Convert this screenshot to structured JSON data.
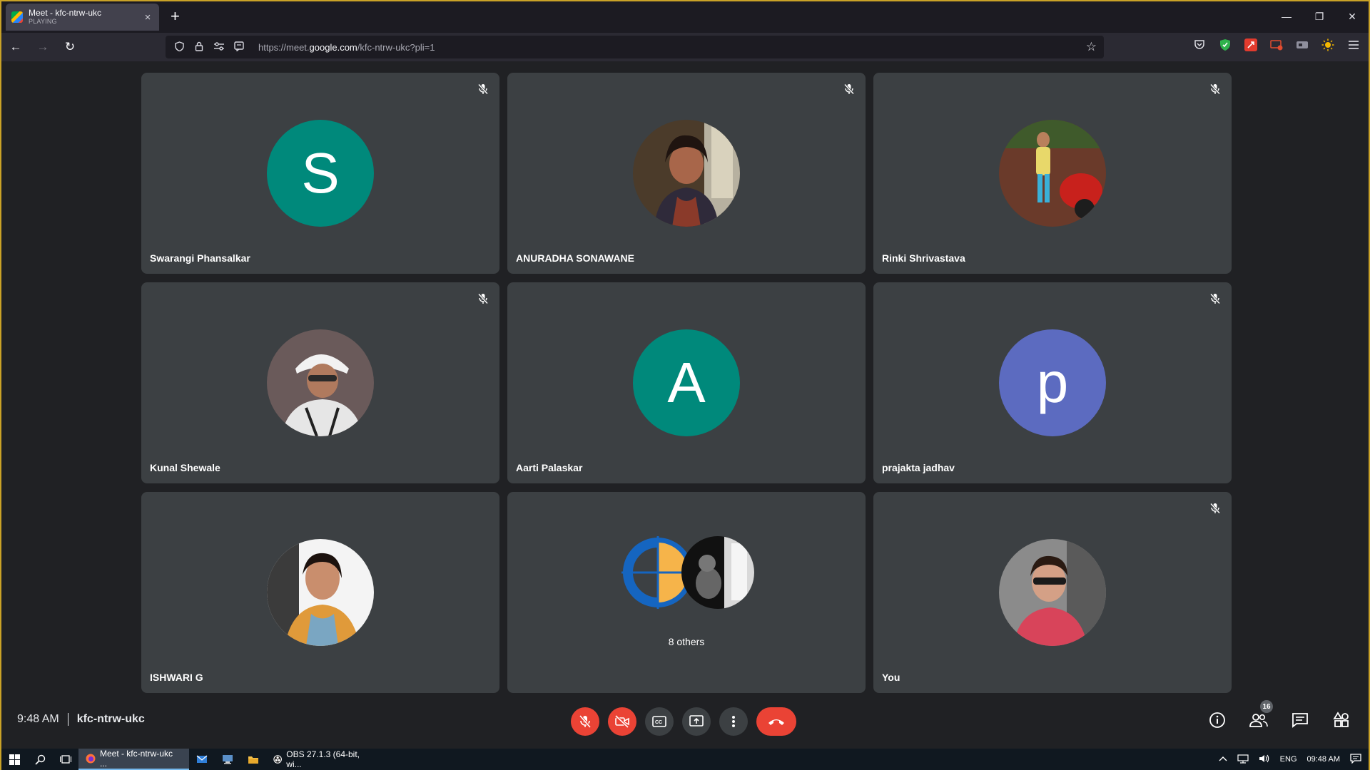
{
  "browser": {
    "tab": {
      "title": "Meet - kfc-ntrw-ukc",
      "subtitle": "PLAYING",
      "close": "×"
    },
    "new_tab": "+",
    "window_controls": {
      "minimize": "—",
      "restore": "❐",
      "close": "✕"
    },
    "nav": {
      "back": "←",
      "forward": "→",
      "reload": "↻"
    },
    "url": {
      "prefix": "https://meet.",
      "host": "google.com",
      "path": "/kfc-ntrw-ukc?pli=1"
    },
    "star": "☆"
  },
  "participants": [
    {
      "name": "Swarangi Phansalkar",
      "initial": "S",
      "avatar_color": "#00897b",
      "muted": true,
      "avatar_type": "initial"
    },
    {
      "name": "ANURADHA SONAWANE",
      "initial": "",
      "avatar_color": "#6d5a3e",
      "muted": true,
      "avatar_type": "photo"
    },
    {
      "name": "Rinki Shrivastava",
      "initial": "",
      "avatar_color": "#8a4b3c",
      "muted": true,
      "avatar_type": "photo"
    },
    {
      "name": "Kunal Shewale",
      "initial": "",
      "avatar_color": "#c9c9c9",
      "muted": true,
      "avatar_type": "photo"
    },
    {
      "name": "Aarti Palaskar",
      "initial": "A",
      "avatar_color": "#00897b",
      "muted": false,
      "avatar_type": "initial"
    },
    {
      "name": "prajakta jadhav",
      "initial": "p",
      "avatar_color": "#5c6bc0",
      "muted": true,
      "avatar_type": "initial"
    },
    {
      "name": "ISHWARI G",
      "initial": "",
      "avatar_color": "#d89a4a",
      "muted": false,
      "avatar_type": "photo"
    },
    {
      "name": "",
      "others_label": "8 others",
      "muted": false,
      "avatar_type": "group"
    },
    {
      "name": "You",
      "initial": "",
      "avatar_color": "#b8455a",
      "muted": true,
      "avatar_type": "photo"
    }
  ],
  "meeting": {
    "time": "9:48 AM",
    "code": "kfc-ntrw-ukc"
  },
  "people_count": "16",
  "colors": {
    "danger": "#ea4335",
    "tile": "#3c4043",
    "bg": "#202124"
  },
  "taskbar": {
    "browser_app": "Meet - kfc-ntrw-ukc ...",
    "obs_app": "OBS 27.1.3 (64-bit, wi...",
    "language": "ENG",
    "clock": "09:48 AM"
  }
}
